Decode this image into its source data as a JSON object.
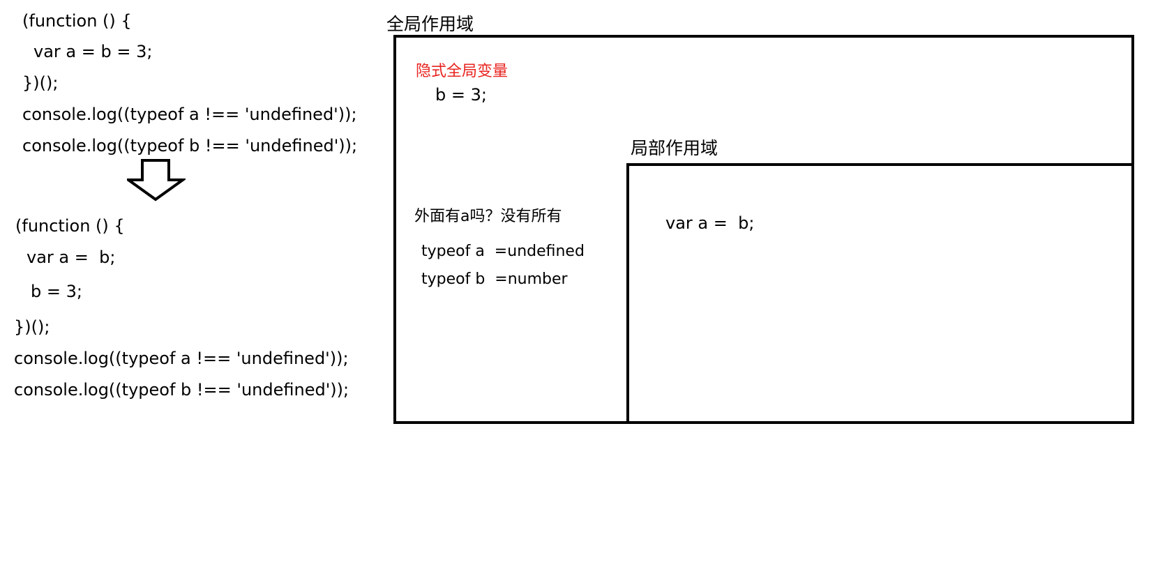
{
  "code_before": {
    "lines": [
      "(function () {",
      "var a = b = 3;",
      "})();",
      "console.log((typeof a !== 'undefined'));",
      "console.log((typeof b !== 'undefined'));"
    ]
  },
  "code_after": {
    "lines": [
      "(function () {",
      "var a =  b;",
      "b = 3;",
      "})();",
      "console.log((typeof a !== 'undefined'));",
      "console.log((typeof b !== 'undefined'));"
    ]
  },
  "global_scope": {
    "title": "全局作用域",
    "implicit_label": "隐式全局变量",
    "implicit_code": "b = 3;",
    "question": "外面有a吗？没有所有",
    "typeof_a": "typeof a  =undefined",
    "typeof_b": "typeof b  =number"
  },
  "local_scope": {
    "title": "局部作用域",
    "code": "var a =  b;"
  },
  "colors": {
    "highlight": "#e8231f",
    "stroke": "#000000"
  }
}
